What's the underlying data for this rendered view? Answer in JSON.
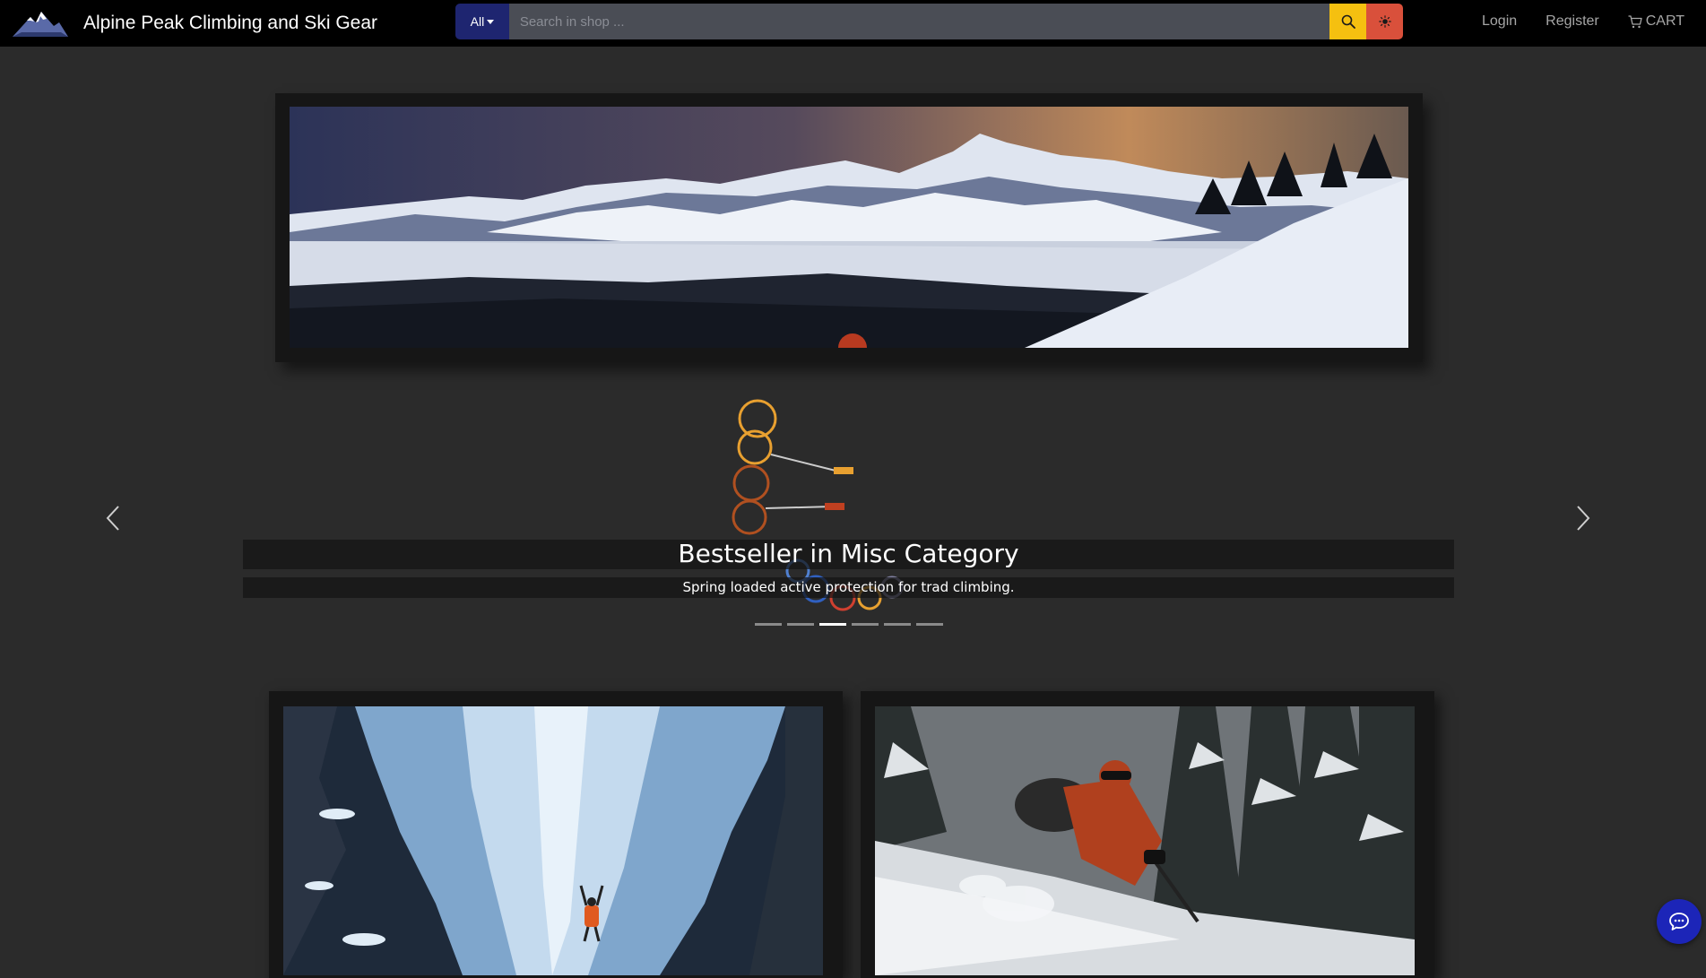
{
  "brand": {
    "name": "Alpine Peak Climbing and Ski Gear",
    "logo_icon": "mountain-logo-icon"
  },
  "search": {
    "scope_label": "All",
    "placeholder": "Search in shop ...",
    "value": "",
    "search_icon": "search-icon",
    "theme_icon": "sun-icon"
  },
  "nav": {
    "login": "Login",
    "register": "Register",
    "cart": "CART",
    "cart_icon": "cart-icon"
  },
  "hero": {
    "image_subject": "snowy-mountain-panorama"
  },
  "carousel": {
    "title": "Bestseller in Misc Category",
    "caption": "Spring loaded active protection for trad climbing.",
    "prev_icon": "chevron-left-icon",
    "next_icon": "chevron-right-icon",
    "slide_count": 6,
    "active_index": 2
  },
  "cards": [
    {
      "image_subject": "ice-climber-on-frozen-waterfall"
    },
    {
      "image_subject": "skier-in-powder-forest"
    }
  ],
  "chat": {
    "icon": "chat-icon"
  },
  "colors": {
    "page_background": "#2b2b2b",
    "navbar": "#000000",
    "search_scope": "#1e2570",
    "search_button": "#f5c010",
    "theme_button": "#d9503b",
    "chat_button": "#1c25b8"
  }
}
